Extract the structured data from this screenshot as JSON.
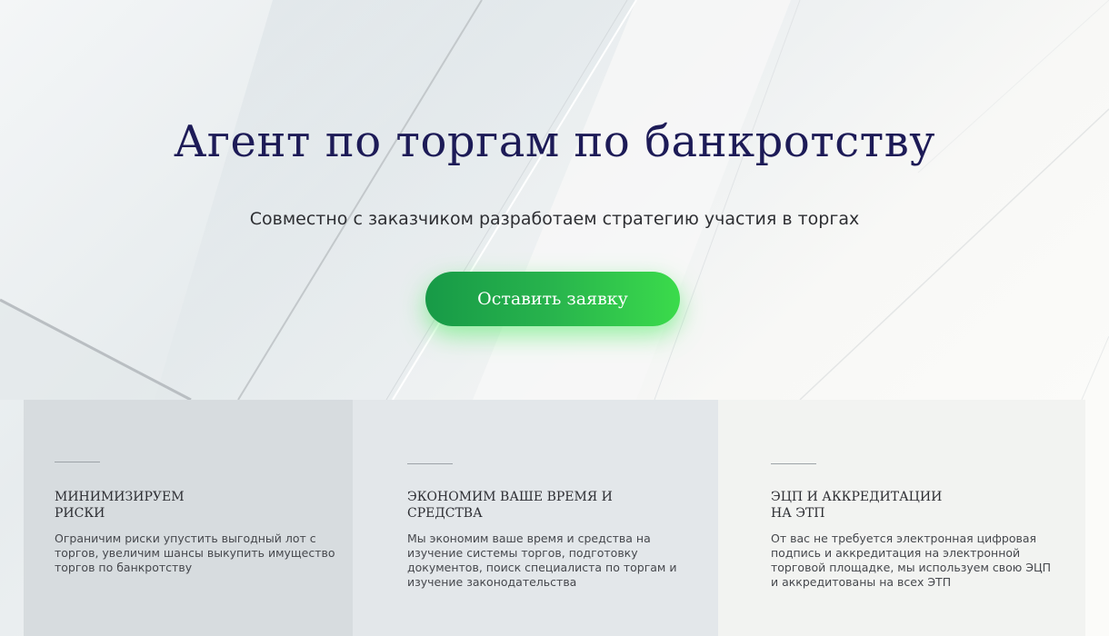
{
  "hero": {
    "title": "Агент по торгам по банкротству",
    "subtitle": "Совместно с заказчиком разработаем стратегию участия в торгах",
    "cta_label": "Оставить заявку"
  },
  "features": [
    {
      "title_lines": [
        "МИНИМИЗИРУЕМ",
        "РИСКИ"
      ],
      "text_lines": [
        "Ограничим риски упустить выгодный лот с",
        "торгов, увеличим шансы выкупить имущество",
        "торгов по банкротству"
      ]
    },
    {
      "title_lines": [
        "ЭКОНОМИМ ВАШЕ ВРЕМЯ И",
        "СРЕДСТВА"
      ],
      "text_lines": [
        "Мы экономим ваше время и средства на",
        "изучение системы торгов, подготовку",
        "документов, поиск специалиста по торгам и",
        "изучение законодательства"
      ]
    },
    {
      "title_lines": [
        "ЭЦП И АККРЕДИТАЦИИ",
        "НА ЭТП"
      ],
      "text_lines": [
        "От вас не требуется электронная цифровая",
        "подпись и аккредитация на электронной",
        "торговой площадке, мы используем свою ЭЦП",
        "и аккредитованы на всех ЭТП"
      ]
    }
  ],
  "colors": {
    "title": "#1d1b57",
    "cta_start": "#179a47",
    "cta_end": "#3bdb4b",
    "card_1": "#d7dcdf",
    "card_2": "#e3e7ea",
    "card_3": "#f2f3f1"
  }
}
